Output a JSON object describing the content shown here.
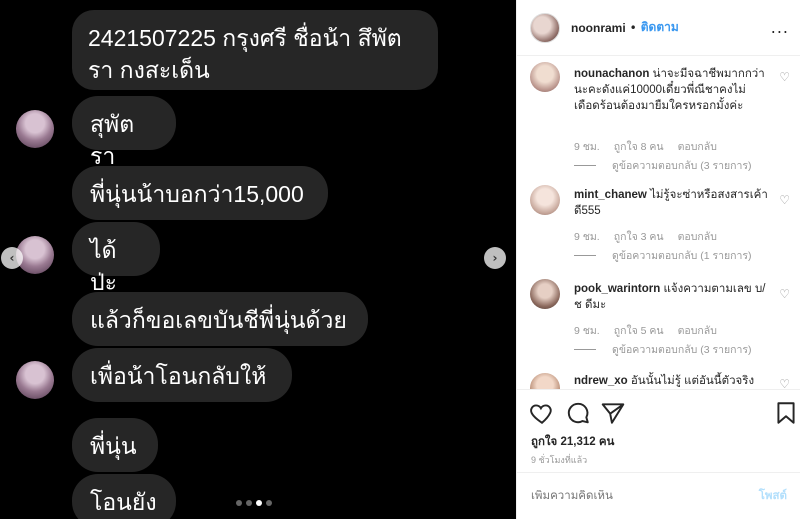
{
  "chat": {
    "messages": [
      "2421507225 กรุงศรี ชื่อน้า สึพัตรา กงสะเด็น",
      "สุพัตรา",
      "พี่นุ่นน้าบอกว่า15,000",
      "ได้ป่ะ",
      "แล้วก็ขอเลขบันชีพี่นุ่นด้วย",
      "เพื่อน้าโอนกลับให้",
      "พี่นุ่น",
      "โอนยัง"
    ]
  },
  "header": {
    "username": "noonrami",
    "separator": "•",
    "follow_label": "ติดตาม",
    "more": "..."
  },
  "comments": [
    {
      "username": "nounachanon",
      "text": "น่าจะมีจฉาชีพมากกว่านะคะดังแค่10000เดี๋ยวพี่ณีชาคงไม่เดือดร้อนต้องมายืมใครหรอกมั้งค่ะ",
      "time": "9 ชม.",
      "likes": "ถูกใจ 8 คน",
      "reply": "ตอบกลับ",
      "view_replies": "ดูข้อความตอบกลับ (3 รายการ)"
    },
    {
      "username": "mint_chanew",
      "text": "ไม่รู้จะซ่าหรือสงสารเค้าดี555",
      "time": "9 ชม.",
      "likes": "ถูกใจ 3 คน",
      "reply": "ตอบกลับ",
      "view_replies": "ดูข้อความตอบกลับ (1 รายการ)"
    },
    {
      "username": "pook_warintorn",
      "text": "แจ้งความตามเลข บ/ช ดีมะ",
      "time": "9 ชม.",
      "likes": "ถูกใจ 5 คน",
      "reply": "ตอบกลับ",
      "view_replies": "ดูข้อความตอบกลับ (3 รายการ)"
    },
    {
      "username": "ndrew_xo",
      "text": "อันนั้นไม่รู้ แต่อันนี้ตัวจริง"
    }
  ],
  "post": {
    "likes": "ถูกใจ 21,312 คน",
    "posted": "9 ชั่วโมงที่แล้ว"
  },
  "add_comment": {
    "placeholder": "เพิ่มความคิดเห็น",
    "post_label": "โพสต์"
  },
  "icons": {
    "heart": "heart-icon",
    "comment": "comment-icon",
    "share": "share-icon",
    "save": "bookmark-icon"
  }
}
